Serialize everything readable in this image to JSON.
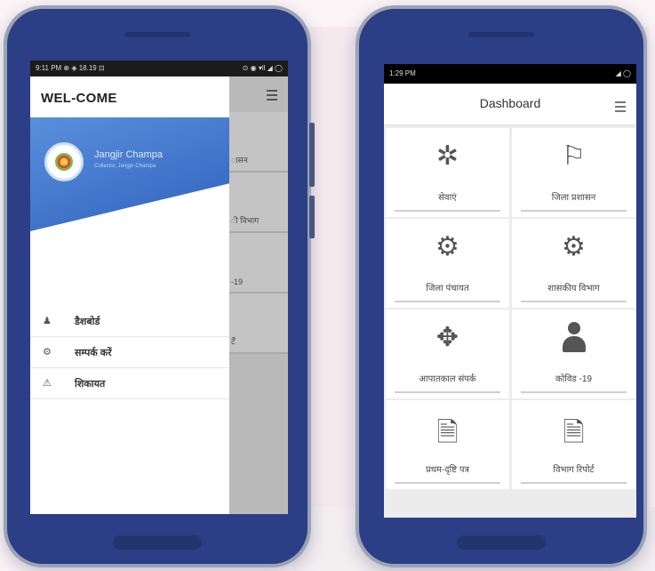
{
  "left_phone": {
    "status_left": "9:11 PM ⊕ ◈ 18.19 ⊡",
    "status_right": "⊙ ◉ ▾ll ◢ ◯",
    "drawer_title": "WEL-COME",
    "user_name": "Jangjir Champa",
    "user_subtitle": "Collector, Janjgir-Champa",
    "menu_items": [
      {
        "icon": "user-icon",
        "glyph": "♟",
        "label": "डैशबोर्ड"
      },
      {
        "icon": "gear-icon",
        "glyph": "⚙",
        "label": "सम्पर्क करें"
      },
      {
        "icon": "warning-icon",
        "glyph": "⚠",
        "label": "शिकायत"
      }
    ],
    "background_tiles": [
      "ासन",
      "ी विभाग",
      "-19",
      "र्टें"
    ]
  },
  "right_phone": {
    "status_time": "1:29 PM",
    "status_icons": "◢ ◯",
    "title": "Dashboard",
    "tiles": [
      {
        "icon": "network-icon",
        "glyph": "✲",
        "label": "सेवाएं"
      },
      {
        "icon": "flag-icon",
        "glyph": "⚐",
        "label": "जिला प्रशासन"
      },
      {
        "icon": "settings-icon",
        "glyph": "⚙",
        "label": "जिला पंचायत"
      },
      {
        "icon": "settings-icon",
        "glyph": "⚙",
        "label": "शासकीय विभाग"
      },
      {
        "icon": "move-icon",
        "glyph": "✥",
        "label": "आपातकाल संपर्क"
      },
      {
        "icon": "person-icon",
        "glyph": "",
        "label": "कोविड -19"
      },
      {
        "icon": "document-icon",
        "glyph": "🗎",
        "label": "प्रथम-दृष्टि पत्र"
      },
      {
        "icon": "document-icon",
        "glyph": "🗎",
        "label": "विभाग रिपोर्ट"
      }
    ]
  }
}
